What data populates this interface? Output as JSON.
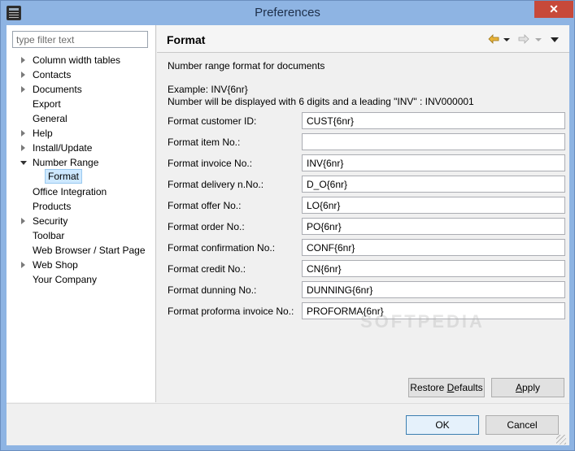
{
  "window": {
    "title": "Preferences",
    "close_glyph": "✕"
  },
  "sidebar": {
    "filter_placeholder": "type filter text",
    "items": [
      {
        "label": "Column width tables",
        "expandable": true
      },
      {
        "label": "Contacts",
        "expandable": true
      },
      {
        "label": "Documents",
        "expandable": true
      },
      {
        "label": "Export",
        "expandable": false
      },
      {
        "label": "General",
        "expandable": false
      },
      {
        "label": "Help",
        "expandable": true
      },
      {
        "label": "Install/Update",
        "expandable": true
      },
      {
        "label": "Number Range",
        "expandable": true,
        "expanded": true
      },
      {
        "label": "Format",
        "selected": true
      },
      {
        "label": "Office Integration",
        "expandable": false
      },
      {
        "label": "Products",
        "expandable": false
      },
      {
        "label": "Security",
        "expandable": true
      },
      {
        "label": "Toolbar",
        "expandable": false
      },
      {
        "label": "Web Browser / Start Page",
        "expandable": false
      },
      {
        "label": "Web Shop",
        "expandable": true
      },
      {
        "label": "Your Company",
        "expandable": false
      }
    ]
  },
  "page": {
    "title": "Format",
    "description": "Number range format for documents",
    "example_line1": "Example:  INV{6nr}",
    "example_line2": "Number will be displayed with 6 digits and a leading \"INV\" : INV000001",
    "fields": [
      {
        "label": "Format customer ID:",
        "value": "CUST{6nr}"
      },
      {
        "label": "Format item No.:",
        "value": ""
      },
      {
        "label": "Format invoice No.:",
        "value": "INV{6nr}"
      },
      {
        "label": "Format delivery n.No.:",
        "value": "D_O{6nr}"
      },
      {
        "label": "Format offer No.:",
        "value": "LO{6nr}"
      },
      {
        "label": "Format order No.:",
        "value": "PO{6nr}"
      },
      {
        "label": "Format confirmation No.:",
        "value": "CONF{6nr}"
      },
      {
        "label": "Format credit No.:",
        "value": "CN{6nr}"
      },
      {
        "label": "Format dunning No.:",
        "value": "DUNNING{6nr}"
      },
      {
        "label": "Format proforma invoice No.:",
        "value": "PROFORMA{6nr}"
      }
    ],
    "restore_defaults_pre": "Restore ",
    "restore_defaults_ul": "D",
    "restore_defaults_post": "efaults",
    "apply_ul": "A",
    "apply_post": "pply"
  },
  "dialog": {
    "ok_label": "OK",
    "cancel_label": "Cancel"
  },
  "watermark": "SOFTPEDIA",
  "colors": {
    "titlebar": "#8eb4e3",
    "close_button": "#c7493a",
    "back_arrow": "#e8b339",
    "selection": "#cde8ff"
  },
  "icons": {
    "back": "arrow-left-icon",
    "forward": "arrow-right-icon",
    "view_menu": "chevron-down-icon"
  }
}
